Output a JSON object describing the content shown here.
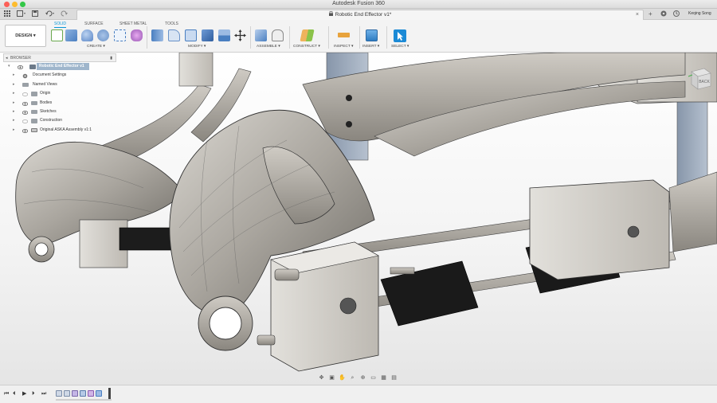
{
  "window": {
    "title": "Autodesk Fusion 360",
    "controls": [
      "close",
      "minimize",
      "maximize"
    ]
  },
  "tabbar": {
    "document_title": "Robotic End Effector v1*",
    "user_name": "Keqing Song",
    "quick_icons": [
      "grid-icon",
      "file-icon",
      "save-icon",
      "undo-icon",
      "redo-icon"
    ],
    "right_icons": [
      "new-tab-icon",
      "extensions-icon",
      "job-status-icon",
      "notifications-icon",
      "help-icon"
    ]
  },
  "toolbar": {
    "workspace_button": "DESIGN ▾",
    "workspace_tabs": [
      {
        "label": "SOLID",
        "active": true
      },
      {
        "label": "SURFACE",
        "active": false
      },
      {
        "label": "SHEET METAL",
        "active": false
      },
      {
        "label": "TOOLS",
        "active": false
      }
    ],
    "groups": [
      {
        "label": "CREATE ▾"
      },
      {
        "label": "MODIFY ▾"
      },
      {
        "label": "ASSEMBLE ▾"
      },
      {
        "label": "CONSTRUCT ▾"
      },
      {
        "label": "INSPECT ▾"
      },
      {
        "label": "INSERT ▾"
      },
      {
        "label": "SELECT ▾"
      }
    ]
  },
  "browser": {
    "header": "BROWSER",
    "items": [
      {
        "label": "Robotic End Effector v1",
        "root": true
      },
      {
        "label": "Document Settings"
      },
      {
        "label": "Named Views"
      },
      {
        "label": "Origin"
      },
      {
        "label": "Bodies"
      },
      {
        "label": "Sketches"
      },
      {
        "label": "Construction"
      },
      {
        "label": "Original ASKA Assembly v1:1"
      }
    ]
  },
  "viewcube": {
    "face_label": "BACK"
  },
  "timeline": {
    "controls": [
      "⏮",
      "⏴",
      "▶",
      "⏵",
      "⏭"
    ]
  },
  "colors": {
    "accent": "#0696d7",
    "root_highlight": "#9fb6cc"
  }
}
